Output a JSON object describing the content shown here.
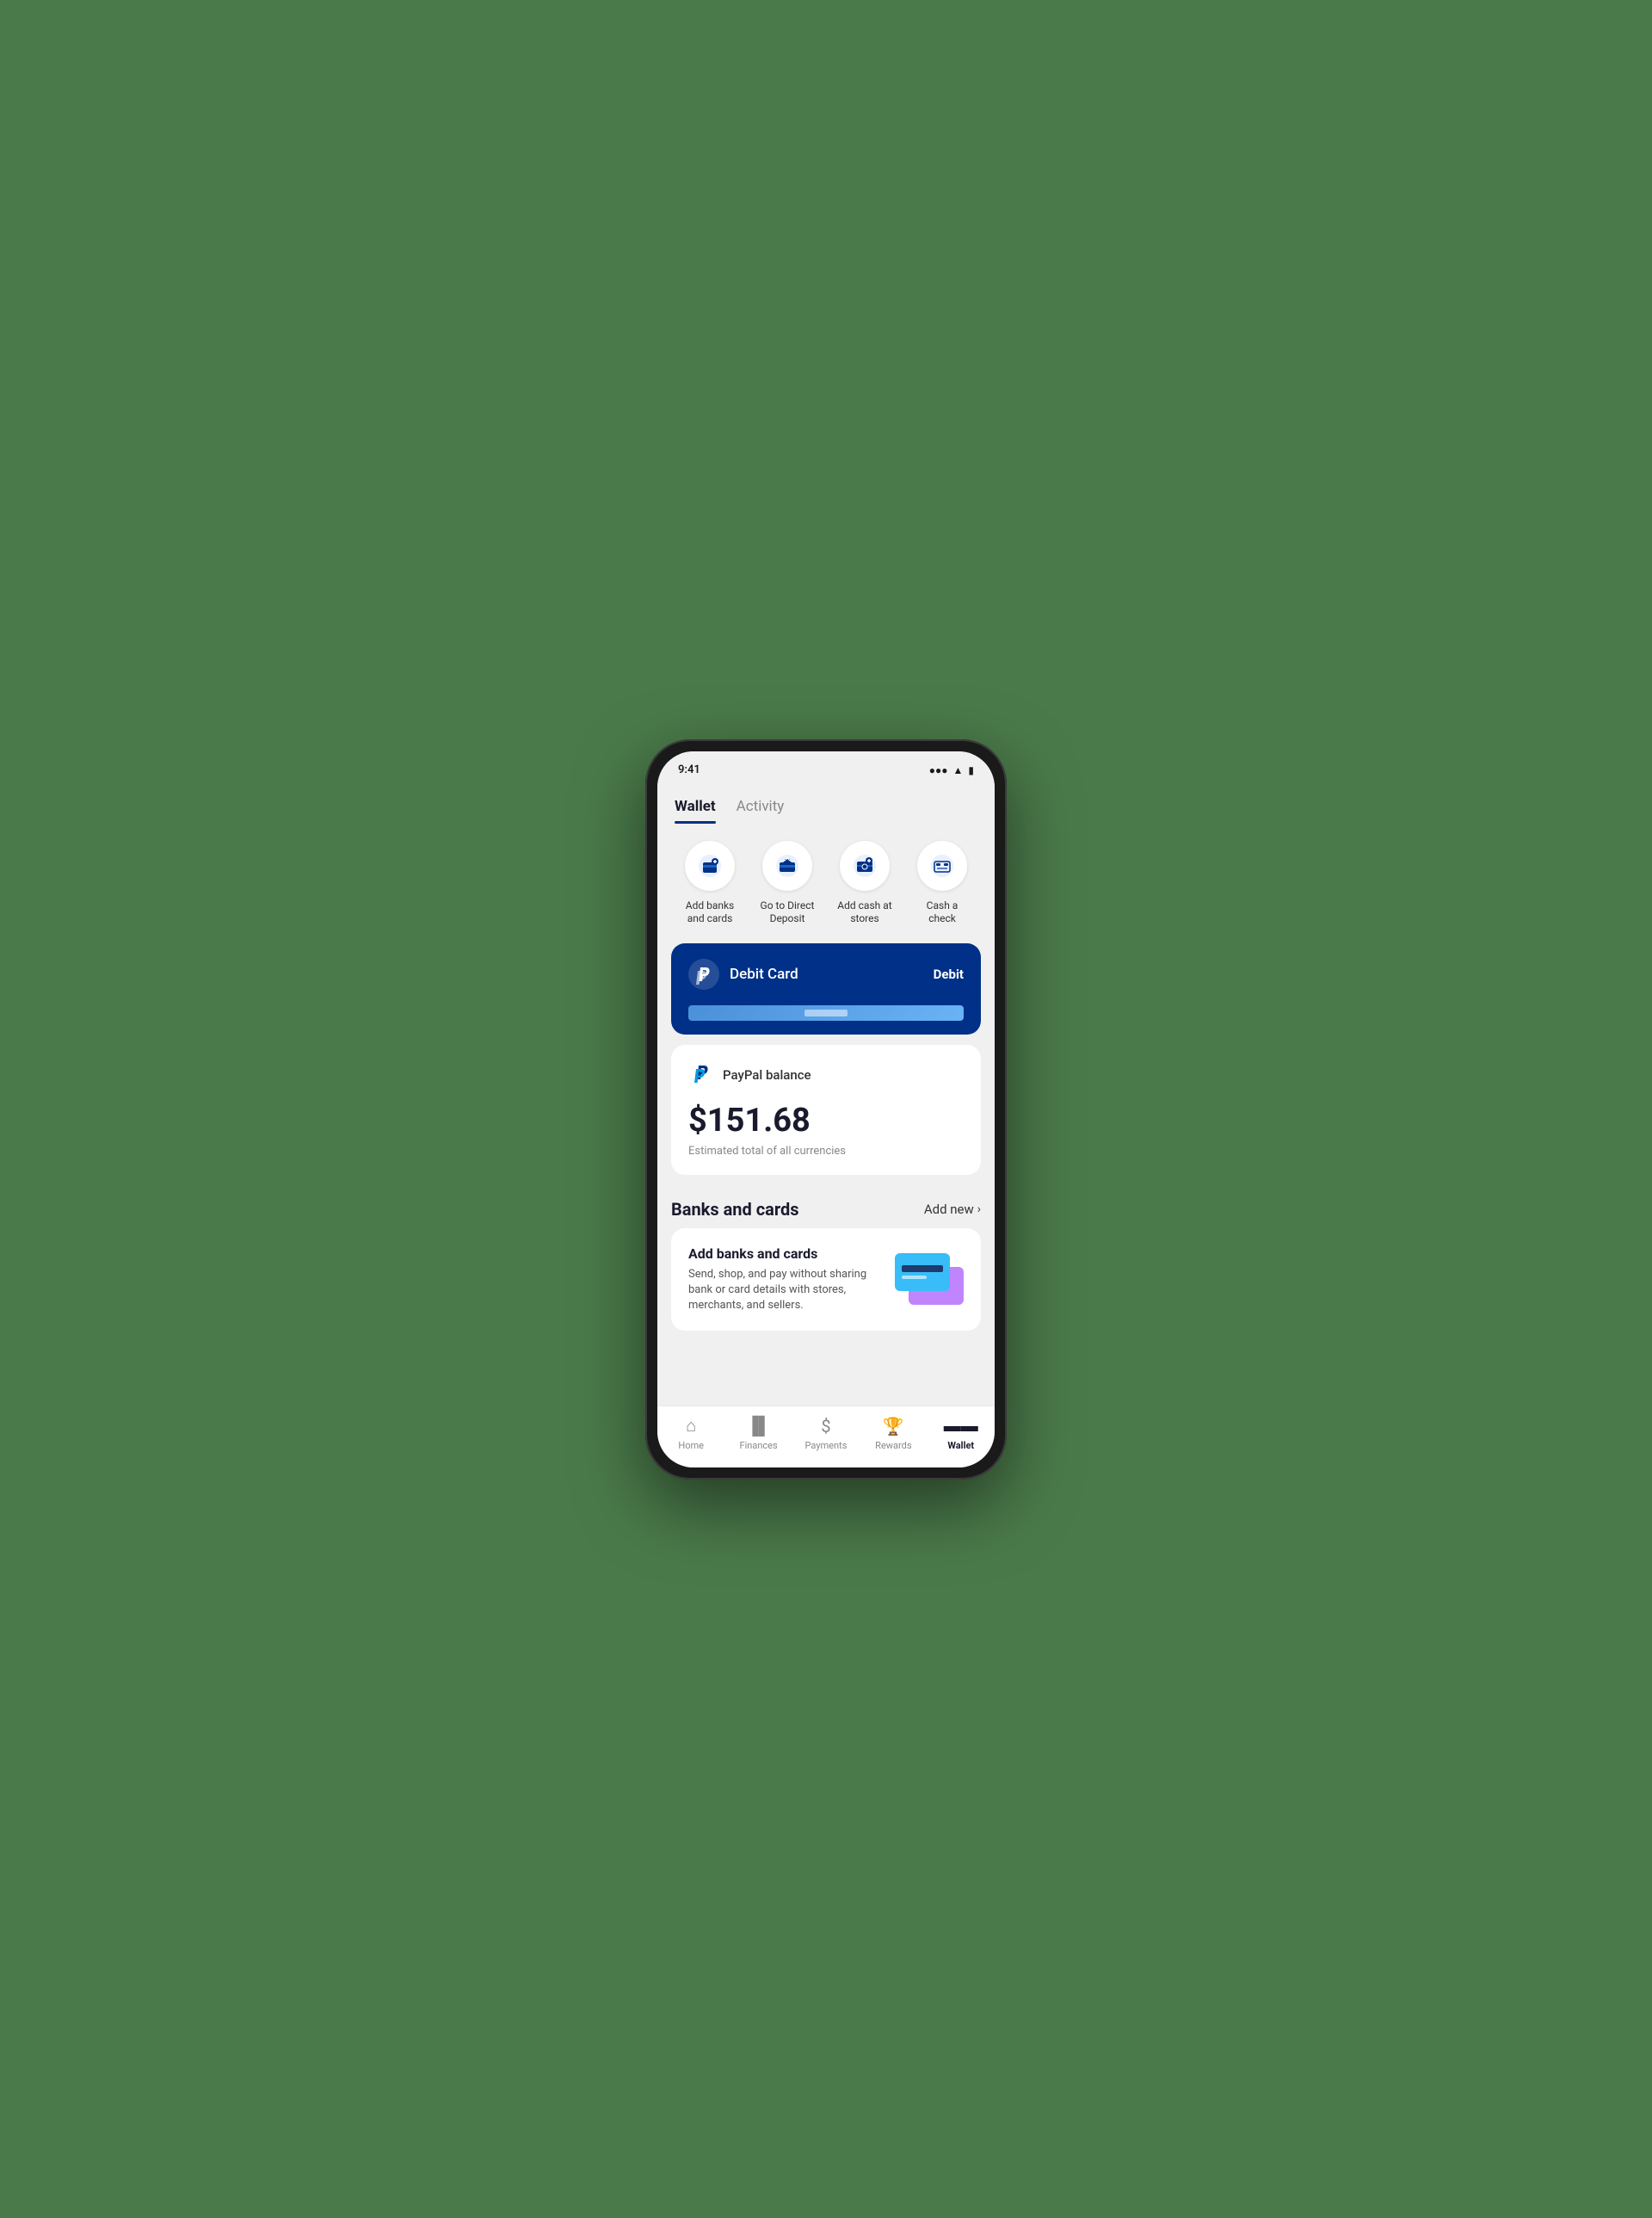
{
  "tabs": [
    {
      "id": "wallet",
      "label": "Wallet",
      "active": true
    },
    {
      "id": "activity",
      "label": "Activity",
      "active": false
    }
  ],
  "quick_actions": [
    {
      "id": "add-banks",
      "label": "Add banks and cards",
      "icon": "bank"
    },
    {
      "id": "direct-deposit",
      "label": "Go to Direct Deposit",
      "icon": "deposit"
    },
    {
      "id": "add-cash",
      "label": "Add cash at stores",
      "icon": "cash"
    },
    {
      "id": "cash-check",
      "label": "Cash a check",
      "icon": "check"
    }
  ],
  "debit_card": {
    "title": "Debit Card",
    "badge": "Debit"
  },
  "balance": {
    "label": "PayPal balance",
    "amount": "$151.68",
    "subtitle": "Estimated total of all currencies"
  },
  "banks_section": {
    "title": "Banks and cards",
    "add_new": "Add new",
    "card_title": "Add banks and cards",
    "card_desc": "Send, shop, and pay without sharing bank or card details with stores, merchants, and sellers."
  },
  "bottom_nav": [
    {
      "id": "home",
      "label": "Home",
      "icon": "home",
      "active": false
    },
    {
      "id": "finances",
      "label": "Finances",
      "icon": "finances",
      "active": false
    },
    {
      "id": "payments",
      "label": "Payments",
      "icon": "payments",
      "active": false
    },
    {
      "id": "rewards",
      "label": "Rewards",
      "icon": "rewards",
      "active": false
    },
    {
      "id": "wallet",
      "label": "Wallet",
      "icon": "wallet",
      "active": true
    }
  ]
}
